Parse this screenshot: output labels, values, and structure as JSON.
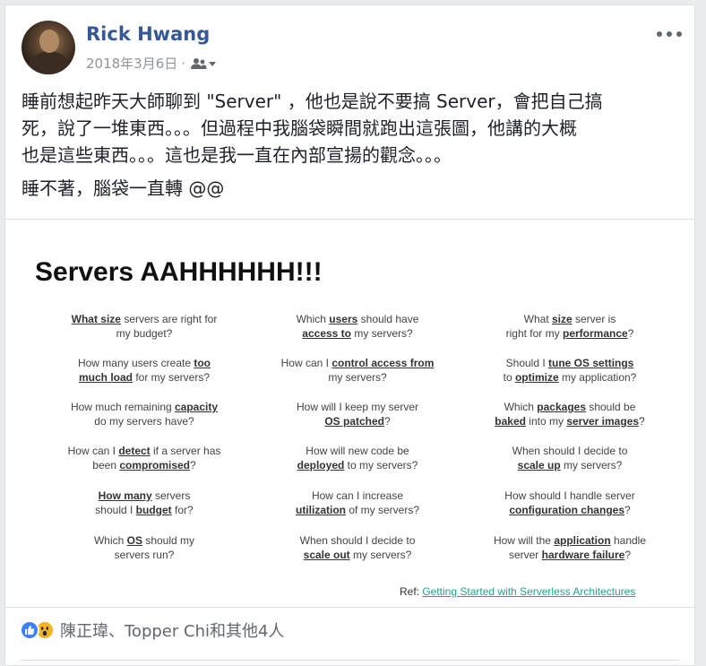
{
  "post": {
    "author": "Rick Hwang",
    "timestamp": "2018年3月6日",
    "separator": "·",
    "audience_icon": "friends-icon",
    "text_lines": [
      "睡前想起昨天大師聊到 \"Server\" ，他也是說不要搞 Server，會把自己搞",
      "死，說了一堆東西。。。但過程中我腦袋瞬間就跑出這張圖，他講的大概",
      "也是這些東西。。。這也是我一直在內部宣揚的觀念。。。"
    ],
    "text_line_2": "睡不著，腦袋一直轉 @@"
  },
  "slide": {
    "title": "Servers AAHHHHHH!!!",
    "columns": [
      [
        {
          "parts": [
            [
              "What size",
              true
            ],
            [
              " servers are right for",
              false
            ]
          ],
          "line2": [
            [
              "my budget?",
              false
            ]
          ]
        },
        {
          "parts": [
            [
              "How many users create ",
              false
            ],
            [
              "too",
              true
            ]
          ],
          "line2": [
            [
              "much load",
              true
            ],
            [
              " for my servers?",
              false
            ]
          ]
        },
        {
          "parts": [
            [
              "How much remaining ",
              false
            ],
            [
              "capacity",
              true
            ]
          ],
          "line2": [
            [
              "do my servers have?",
              false
            ]
          ]
        },
        {
          "parts": [
            [
              "How can I ",
              false
            ],
            [
              "detect",
              true
            ],
            [
              " if a server has",
              false
            ]
          ],
          "line2": [
            [
              "been ",
              false
            ],
            [
              "compromised",
              true
            ],
            [
              "?",
              false
            ]
          ]
        },
        {
          "parts": [
            [
              "How many",
              true
            ],
            [
              " servers",
              false
            ]
          ],
          "line2": [
            [
              "should I ",
              false
            ],
            [
              "budget",
              true
            ],
            [
              " for?",
              false
            ]
          ]
        },
        {
          "parts": [
            [
              "Which ",
              false
            ],
            [
              "OS",
              true
            ],
            [
              " should my",
              false
            ]
          ],
          "line2": [
            [
              "servers run?",
              false
            ]
          ]
        }
      ],
      [
        {
          "parts": [
            [
              "Which ",
              false
            ],
            [
              "users",
              true
            ],
            [
              " should have",
              false
            ]
          ],
          "line2": [
            [
              "access to",
              true
            ],
            [
              " my servers?",
              false
            ]
          ]
        },
        {
          "parts": [
            [
              "How can I ",
              false
            ],
            [
              "control access from",
              true
            ]
          ],
          "line2": [
            [
              "my servers?",
              false
            ]
          ]
        },
        {
          "parts": [
            [
              "How will I keep my server",
              false
            ]
          ],
          "line2": [
            [
              "OS patched",
              true
            ],
            [
              "?",
              false
            ]
          ]
        },
        {
          "parts": [
            [
              "How will new code be",
              false
            ]
          ],
          "line2": [
            [
              "deployed",
              true
            ],
            [
              " to my servers?",
              false
            ]
          ]
        },
        {
          "parts": [
            [
              "How can I increase",
              false
            ]
          ],
          "line2": [
            [
              "utilization",
              true
            ],
            [
              " of my servers?",
              false
            ]
          ]
        },
        {
          "parts": [
            [
              "When should I decide to",
              false
            ]
          ],
          "line2": [
            [
              "scale out",
              true
            ],
            [
              " my servers?",
              false
            ]
          ]
        }
      ],
      [
        {
          "parts": [
            [
              "What ",
              false
            ],
            [
              "size",
              true
            ],
            [
              " server is",
              false
            ]
          ],
          "line2": [
            [
              "right for my ",
              false
            ],
            [
              "performance",
              true
            ],
            [
              "?",
              false
            ]
          ]
        },
        {
          "parts": [
            [
              "Should I ",
              false
            ],
            [
              "tune OS settings",
              true
            ]
          ],
          "line2": [
            [
              "to ",
              false
            ],
            [
              "optimize",
              true
            ],
            [
              " my application?",
              false
            ]
          ]
        },
        {
          "parts": [
            [
              "Which ",
              false
            ],
            [
              "packages",
              true
            ],
            [
              " should be",
              false
            ]
          ],
          "line2": [
            [
              "baked",
              true
            ],
            [
              " into my ",
              false
            ],
            [
              "server images",
              true
            ],
            [
              "?",
              false
            ]
          ]
        },
        {
          "parts": [
            [
              "When should I decide to",
              false
            ]
          ],
          "line2": [
            [
              "scale up",
              true
            ],
            [
              " my servers?",
              false
            ]
          ]
        },
        {
          "parts": [
            [
              "How should I handle server",
              false
            ]
          ],
          "line2": [
            [
              "configuration changes",
              true
            ],
            [
              "?",
              false
            ]
          ]
        },
        {
          "parts": [
            [
              "How will the ",
              false
            ],
            [
              "application",
              true
            ],
            [
              " handle",
              false
            ]
          ],
          "line2": [
            [
              "server ",
              false
            ],
            [
              "hardware failure",
              true
            ],
            [
              "?",
              false
            ]
          ]
        }
      ]
    ],
    "ref_label": "Ref: ",
    "ref_link": "Getting Started with Serverless Architectures"
  },
  "reactions": {
    "icons": [
      "like-icon",
      "wow-icon"
    ],
    "label": "陳正瑋、Topper Chi和其他4人"
  },
  "colors": {
    "author_link": "#365899",
    "meta_gray": "#90949c",
    "like_blue": "#4080ff",
    "wow_yellow": "#f7b125",
    "ref_link": "#2a9d8f"
  }
}
